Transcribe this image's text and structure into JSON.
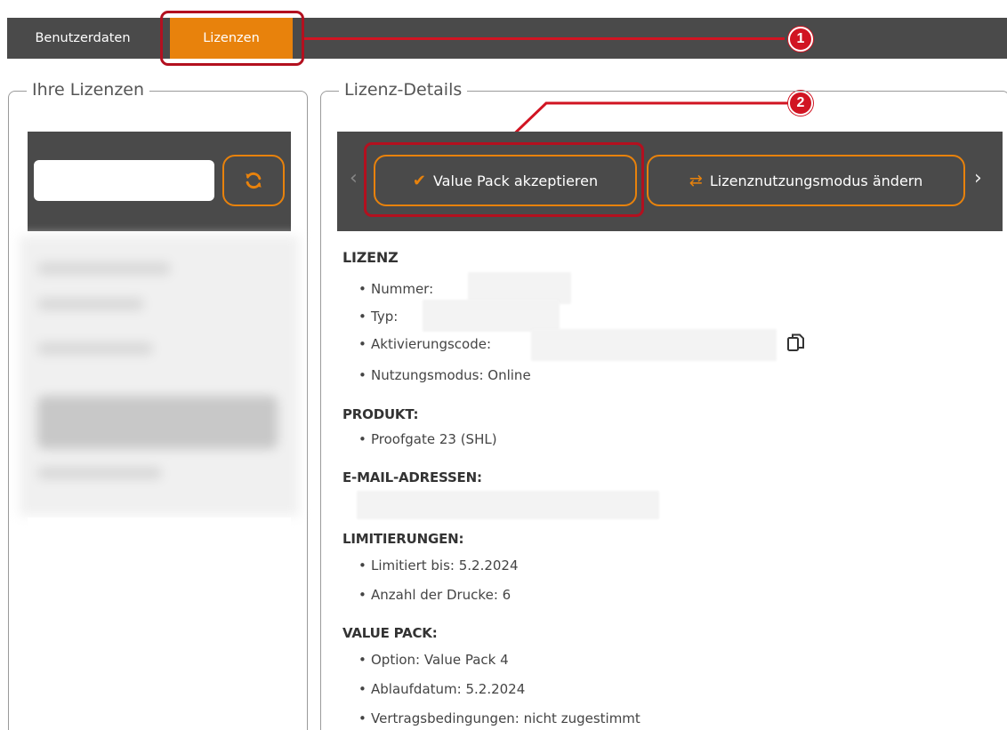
{
  "tabs": {
    "user_data": "Benutzerdaten",
    "licenses": "Lizenzen"
  },
  "callouts": {
    "one": "1",
    "two": "2"
  },
  "left_panel": {
    "title": "Ihre Lizenzen",
    "search_value": "",
    "refresh_icon": "refresh-icon"
  },
  "right_panel": {
    "title": "Lizenz-Details",
    "buttons": {
      "accept_value_pack": "Value Pack akzeptieren",
      "change_mode": "Lizenznutzungsmodus ändern"
    }
  },
  "details": {
    "license": {
      "heading": "LIZENZ",
      "number_label": "Nummer:",
      "type_label": "Typ:",
      "activation_label": "Aktivierungscode:",
      "mode": "Nutzungsmodus: Online"
    },
    "product": {
      "heading": "PRODUKT:",
      "name": "Proofgate 23 (SHL)"
    },
    "emails": {
      "heading": "E-MAIL-ADRESSEN:"
    },
    "limits": {
      "heading": "LIMITIERUNGEN:",
      "until": "Limitiert bis: 5.2.2024",
      "prints": "Anzahl der Drucke: 6"
    },
    "value_pack": {
      "heading": "VALUE PACK:",
      "option": "Option: Value Pack 4",
      "expiry": "Ablaufdatum: 5.2.2024",
      "terms": "Vertragsbedingungen: nicht zugestimmt"
    }
  },
  "colors": {
    "accent": "#e8820c",
    "bar": "#4a4a4a",
    "highlight": "#d11422"
  }
}
